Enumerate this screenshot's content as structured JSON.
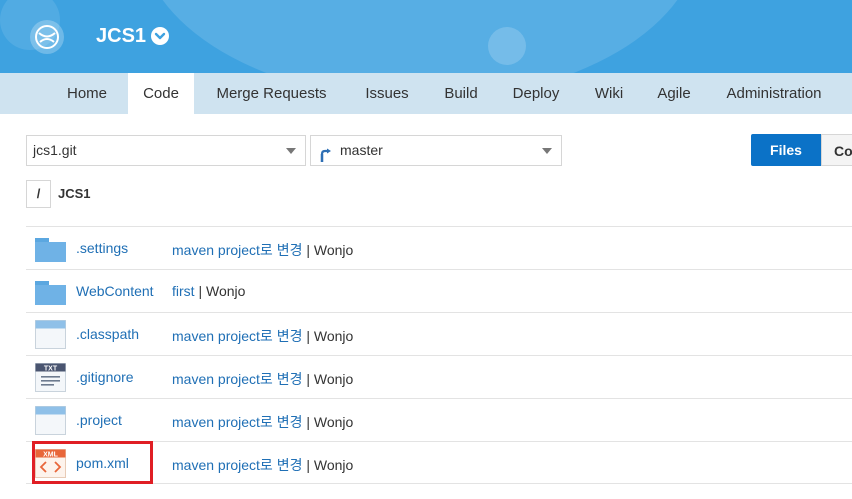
{
  "header": {
    "project_name": "JCS1"
  },
  "nav": {
    "tabs": [
      {
        "label": "Home"
      },
      {
        "label": "Code"
      },
      {
        "label": "Merge Requests"
      },
      {
        "label": "Issues"
      },
      {
        "label": "Build"
      },
      {
        "label": "Deploy"
      },
      {
        "label": "Wiki"
      },
      {
        "label": "Agile"
      },
      {
        "label": "Administration"
      }
    ],
    "active": "Code"
  },
  "repo_select": {
    "value": "jcs1.git"
  },
  "branch_select": {
    "value": "master"
  },
  "view_toggle": {
    "files_label": "Files",
    "commits_label": "Co"
  },
  "breadcrumb": {
    "root": "/",
    "current": "JCS1"
  },
  "files": [
    {
      "name": ".settings",
      "type": "folder",
      "commit_msg": "maven project로 변경",
      "separator": " | ",
      "author": "Wonjo"
    },
    {
      "name": "WebContent",
      "type": "folder",
      "commit_msg": "first",
      "separator": " | ",
      "author": "Wonjo"
    },
    {
      "name": ".classpath",
      "type": "file",
      "commit_msg": "maven project로 변경",
      "separator": " | ",
      "author": "Wonjo"
    },
    {
      "name": ".gitignore",
      "type": "txt",
      "badge": "TXT",
      "commit_msg": "maven project로 변경",
      "separator": " | ",
      "author": "Wonjo"
    },
    {
      "name": ".project",
      "type": "file",
      "commit_msg": "maven project로 변경",
      "separator": " | ",
      "author": "Wonjo"
    },
    {
      "name": "pom.xml",
      "type": "xml",
      "badge": "XML",
      "commit_msg": "maven project로 변경",
      "separator": " | ",
      "author": "Wonjo"
    }
  ],
  "colors": {
    "header_bg": "#3ea2e0",
    "nav_bg": "#cfe3f0",
    "link": "#1f6fb5",
    "primary_button": "#0b72c7",
    "highlight_border": "#e01e24"
  }
}
